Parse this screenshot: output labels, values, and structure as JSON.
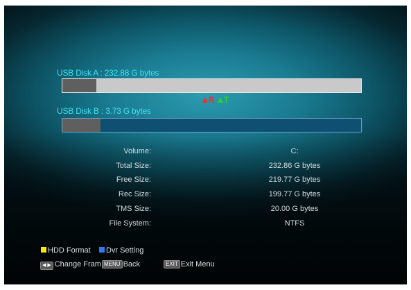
{
  "disks": {
    "a": {
      "label": "USB Disk A : 232.88 G bytes",
      "usage_fraction": 0.115
    },
    "b": {
      "label": "USB Disk B : 3.73 G bytes",
      "usage_fraction": 0.128
    }
  },
  "indicators": {
    "r": "R",
    "t": "T"
  },
  "info": [
    {
      "label": "Volume:",
      "value": "C:"
    },
    {
      "label": "Total Size:",
      "value": "232.86 G bytes"
    },
    {
      "label": "Free Size:",
      "value": "219.77 G bytes"
    },
    {
      "label": "Rec Size:",
      "value": "199.77 G bytes"
    },
    {
      "label": "TMS Size:",
      "value": "20.00 G bytes"
    },
    {
      "label": "File System:",
      "value": "NTFS"
    }
  ],
  "legend": {
    "hdd_format": "HDD Format",
    "dvr_setting": "Dvr Setting",
    "change_frame": "Change Fram",
    "menu_key": "MENU",
    "back": "Back",
    "exit_key": "EXIT",
    "exit_menu": "Exit Menu"
  },
  "colors": {
    "label_cyan": "#3fe0f0",
    "yellow_key": "#ffe600",
    "blue_key": "#2f7be8",
    "rec_indicator": "#ff2a2a",
    "tms_indicator": "#2ad12a"
  }
}
